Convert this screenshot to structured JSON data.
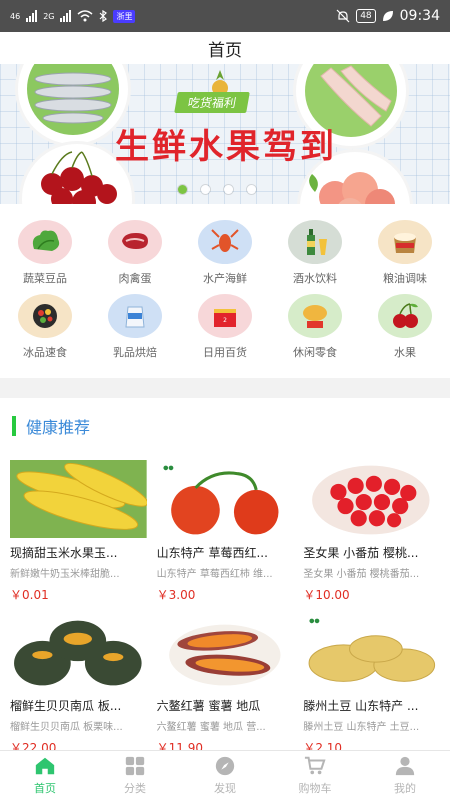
{
  "status_bar": {
    "carrier_left": "46",
    "carrier_right": "2G",
    "app_badge": "浙里",
    "battery": "48",
    "time": "09:34"
  },
  "page_title": "首页",
  "banner": {
    "subtitle": "吃货福利",
    "title": "生鲜水果驾到",
    "dot_count": 4,
    "active_dot": 0
  },
  "categories": [
    {
      "label": "蔬菜豆品",
      "icon": "vegetable-icon",
      "bg": "#f7d7d9"
    },
    {
      "label": "肉禽蛋",
      "icon": "meat-icon",
      "bg": "#f7d7d9"
    },
    {
      "label": "水产海鲜",
      "icon": "seafood-icon",
      "bg": "#cfe0f5"
    },
    {
      "label": "酒水饮料",
      "icon": "drinks-icon",
      "bg": "#d5ddd5"
    },
    {
      "label": "粮油调味",
      "icon": "grain-oil-icon",
      "bg": "#f6e4c6"
    },
    {
      "label": "冰品速食",
      "icon": "frozen-food-icon",
      "bg": "#f6e4c6"
    },
    {
      "label": "乳品烘焙",
      "icon": "dairy-icon",
      "bg": "#cfe0f5"
    },
    {
      "label": "日用百货",
      "icon": "daily-goods-icon",
      "bg": "#f7d7d9"
    },
    {
      "label": "休闲零食",
      "icon": "snacks-icon",
      "bg": "#d6ecc9"
    },
    {
      "label": "水果",
      "icon": "fruit-icon",
      "bg": "#d6ecc9"
    }
  ],
  "section": {
    "title": "健康推荐",
    "accent": "#27c93f"
  },
  "products": [
    {
      "name": "现摘甜玉米水果玉...",
      "desc": "新鲜嫩牛奶玉米棒甜脆...",
      "price": "￥0.01",
      "image": "corn"
    },
    {
      "name": "山东特产 草莓西红...",
      "desc": "山东特产 草莓西红柿 维...",
      "price": "￥3.00",
      "image": "tomato"
    },
    {
      "name": "圣女果 小番茄 樱桃...",
      "desc": "圣女果 小番茄 樱桃番茄...",
      "price": "￥10.00",
      "image": "cherry-tomato"
    },
    {
      "name": "榴鲜生贝贝南瓜 板...",
      "desc": "榴鲜生贝贝南瓜 板栗味...",
      "price": "￥22.00",
      "image": "pumpkin"
    },
    {
      "name": "六鳌红薯 蜜薯 地瓜",
      "desc": "六鳌红薯 蜜薯 地瓜 营...",
      "price": "￥11.90",
      "image": "sweet-potato"
    },
    {
      "name": "滕州土豆 山东特产 ...",
      "desc": "滕州土豆 山东特产 土豆...",
      "price": "￥2.10",
      "image": "potato"
    }
  ],
  "tabs": [
    {
      "label": "首页",
      "icon": "home-icon",
      "active": true
    },
    {
      "label": "分类",
      "icon": "category-icon",
      "active": false
    },
    {
      "label": "发现",
      "icon": "discover-icon",
      "active": false
    },
    {
      "label": "购物车",
      "icon": "cart-icon",
      "active": false
    },
    {
      "label": "我的",
      "icon": "profile-icon",
      "active": false
    }
  ],
  "colors": {
    "price": "#e02e24",
    "tab_active": "#2ec56f",
    "tab_inactive": "#b5b5b5",
    "banner_title": "#e0242b"
  }
}
